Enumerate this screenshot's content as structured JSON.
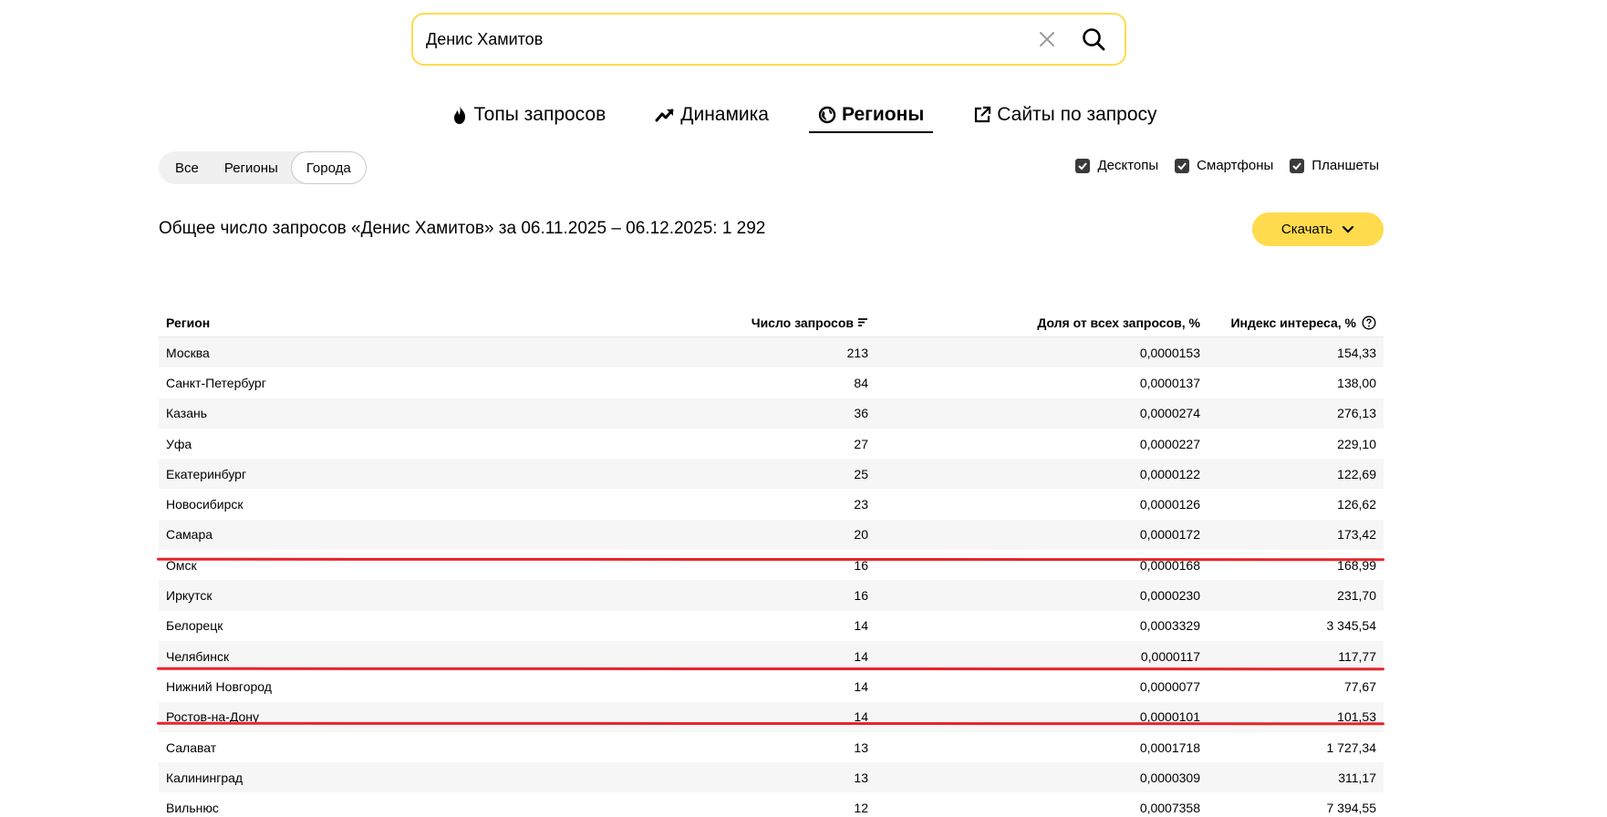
{
  "search": {
    "value": "Денис Хамитов"
  },
  "tabs": [
    {
      "label": "Топы запросов",
      "icon": "fire-icon"
    },
    {
      "label": "Динамика",
      "icon": "trend-icon"
    },
    {
      "label": "Регионы",
      "icon": "globe-icon",
      "active": true
    },
    {
      "label": "Сайты по запросу",
      "icon": "external-link-icon"
    }
  ],
  "segments": [
    {
      "label": "Все"
    },
    {
      "label": "Регионы"
    },
    {
      "label": "Города",
      "selected": true
    }
  ],
  "devices": [
    {
      "label": "Десктопы",
      "checked": true
    },
    {
      "label": "Смартфоны",
      "checked": true
    },
    {
      "label": "Планшеты",
      "checked": true
    }
  ],
  "summary": {
    "text": "Общее число запросов «Денис Хамитов» за 06.11.2025 – 06.12.2025: 1 292"
  },
  "download": {
    "label": "Скачать"
  },
  "table": {
    "headers": {
      "region": "Регион",
      "count": "Число запросов",
      "share": "Доля от всех запросов, %",
      "index": "Индекс интереса, %"
    },
    "rows": [
      {
        "region": "Москва",
        "count": "213",
        "share": "0,0000153",
        "index": "154,33"
      },
      {
        "region": "Санкт-Петербург",
        "count": "84",
        "share": "0,0000137",
        "index": "138,00"
      },
      {
        "region": "Казань",
        "count": "36",
        "share": "0,0000274",
        "index": "276,13"
      },
      {
        "region": "Уфа",
        "count": "27",
        "share": "0,0000227",
        "index": "229,10"
      },
      {
        "region": "Екатеринбург",
        "count": "25",
        "share": "0,0000122",
        "index": "122,69"
      },
      {
        "region": "Новосибирск",
        "count": "23",
        "share": "0,0000126",
        "index": "126,62"
      },
      {
        "region": "Самара",
        "count": "20",
        "share": "0,0000172",
        "index": "173,42"
      },
      {
        "region": "Омск",
        "count": "16",
        "share": "0,0000168",
        "index": "168,99"
      },
      {
        "region": "Иркутск",
        "count": "16",
        "share": "0,0000230",
        "index": "231,70"
      },
      {
        "region": "Белорецк",
        "count": "14",
        "share": "0,0003329",
        "index": "3 345,54"
      },
      {
        "region": "Челябинск",
        "count": "14",
        "share": "0,0000117",
        "index": "117,77"
      },
      {
        "region": "Нижний Новгород",
        "count": "14",
        "share": "0,0000077",
        "index": "77,67"
      },
      {
        "region": "Ростов-на-Дону",
        "count": "14",
        "share": "0,0000101",
        "index": "101,53"
      },
      {
        "region": "Салават",
        "count": "13",
        "share": "0,0001718",
        "index": "1 727,34"
      },
      {
        "region": "Калининград",
        "count": "13",
        "share": "0,0000309",
        "index": "311,17"
      },
      {
        "region": "Вильнюс",
        "count": "12",
        "share": "0,0007358",
        "index": "7 394,55"
      }
    ]
  },
  "colors": {
    "accent": "#ffdb4d",
    "highlight_underline": "#e8232c"
  }
}
